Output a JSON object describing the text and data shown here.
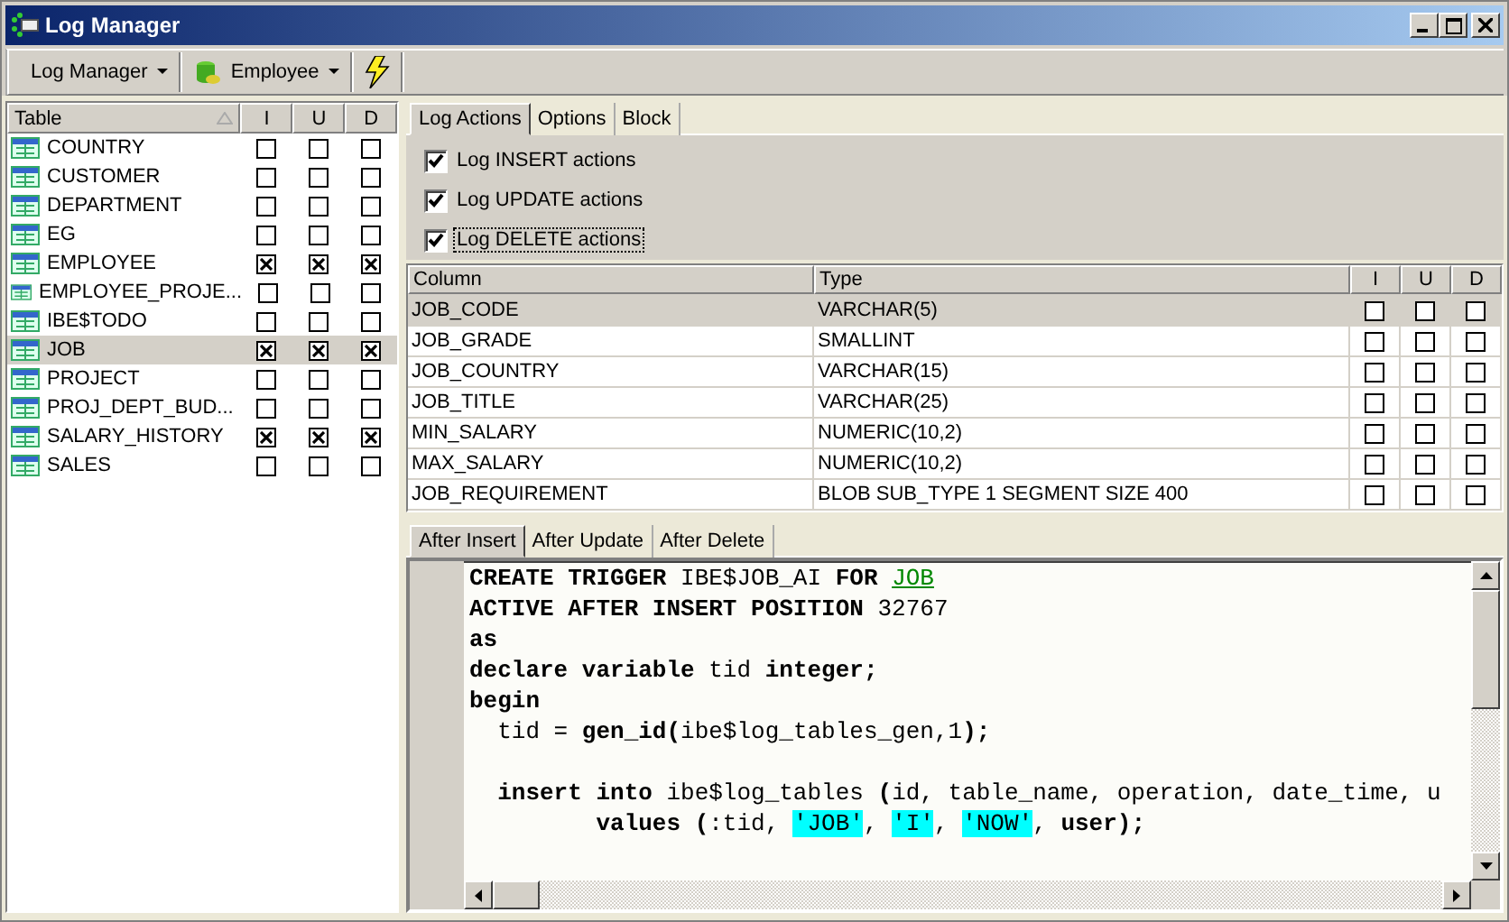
{
  "window": {
    "title": "Log Manager"
  },
  "toolbar": {
    "items": [
      {
        "kind": "dropdown",
        "label": "Log Manager",
        "icon": false
      },
      {
        "kind": "dropdown",
        "label": "Employee",
        "icon": true
      },
      {
        "kind": "action"
      }
    ]
  },
  "tables_list": {
    "columns": [
      "Table",
      "I",
      "U",
      "D"
    ],
    "rows": [
      {
        "name": "COUNTRY",
        "insert": false,
        "update": false,
        "delete": false,
        "selected": false
      },
      {
        "name": "CUSTOMER",
        "insert": false,
        "update": false,
        "delete": false,
        "selected": false
      },
      {
        "name": "DEPARTMENT",
        "insert": false,
        "update": false,
        "delete": false,
        "selected": false
      },
      {
        "name": "EG",
        "insert": false,
        "update": false,
        "delete": false,
        "selected": false
      },
      {
        "name": "EMPLOYEE",
        "insert": true,
        "update": true,
        "delete": true,
        "selected": false
      },
      {
        "name": "EMPLOYEE_PROJE...",
        "insert": false,
        "update": false,
        "delete": false,
        "selected": false
      },
      {
        "name": "IBE$TODO",
        "insert": false,
        "update": false,
        "delete": false,
        "selected": false
      },
      {
        "name": "JOB",
        "insert": true,
        "update": true,
        "delete": true,
        "selected": true
      },
      {
        "name": "PROJECT",
        "insert": false,
        "update": false,
        "delete": false,
        "selected": false
      },
      {
        "name": "PROJ_DEPT_BUD...",
        "insert": false,
        "update": false,
        "delete": false,
        "selected": false
      },
      {
        "name": "SALARY_HISTORY",
        "insert": true,
        "update": true,
        "delete": true,
        "selected": false
      },
      {
        "name": "SALES",
        "insert": false,
        "update": false,
        "delete": false,
        "selected": false
      }
    ]
  },
  "tabs": [
    {
      "label": "Log Actions",
      "selected": true
    },
    {
      "label": "Options",
      "selected": false
    },
    {
      "label": "Block",
      "selected": false
    }
  ],
  "options": [
    {
      "label": "Log INSERT actions",
      "checked": true,
      "focused": false
    },
    {
      "label": "Log UPDATE actions",
      "checked": true,
      "focused": false
    },
    {
      "label": "Log DELETE actions",
      "checked": true,
      "focused": true
    }
  ],
  "columns_grid": {
    "columns": [
      "Column",
      "Type",
      "I",
      "U",
      "D"
    ],
    "rows": [
      {
        "column": "JOB_CODE",
        "type": "VARCHAR(5)",
        "insert": false,
        "update": false,
        "delete": false,
        "selected": true
      },
      {
        "column": "JOB_GRADE",
        "type": "SMALLINT",
        "insert": false,
        "update": false,
        "delete": false,
        "selected": false
      },
      {
        "column": "JOB_COUNTRY",
        "type": "VARCHAR(15)",
        "insert": false,
        "update": false,
        "delete": false,
        "selected": false
      },
      {
        "column": "JOB_TITLE",
        "type": "VARCHAR(25)",
        "insert": false,
        "update": false,
        "delete": false,
        "selected": false
      },
      {
        "column": "MIN_SALARY",
        "type": "NUMERIC(10,2)",
        "insert": false,
        "update": false,
        "delete": false,
        "selected": false
      },
      {
        "column": "MAX_SALARY",
        "type": "NUMERIC(10,2)",
        "insert": false,
        "update": false,
        "delete": false,
        "selected": false
      },
      {
        "column": "JOB_REQUIREMENT",
        "type": "BLOB SUB_TYPE 1 SEGMENT SIZE 400",
        "insert": false,
        "update": false,
        "delete": false,
        "selected": false
      }
    ]
  },
  "trigger_tabs": [
    {
      "label": "After Insert",
      "selected": true
    },
    {
      "label": "After Update",
      "selected": false
    },
    {
      "label": "After Delete",
      "selected": false
    }
  ],
  "code_lines": [
    {
      "kind": "code",
      "segments": [
        {
          "text": "CREATE TRIGGER",
          "kind": "keyword"
        },
        {
          "text": " IBE$JOB_AI ",
          "kind": "plain"
        },
        {
          "text": "FOR ",
          "kind": "keyword"
        },
        {
          "text": "JOB",
          "kind": "object"
        }
      ]
    },
    {
      "kind": "code",
      "segments": [
        {
          "text": "ACTIVE AFTER INSERT POSITION",
          "kind": "keyword"
        },
        {
          "text": " 32767",
          "kind": "plain"
        }
      ]
    },
    {
      "kind": "code",
      "segments": [
        {
          "text": "as",
          "kind": "keyword"
        }
      ]
    },
    {
      "kind": "code",
      "segments": [
        {
          "text": "declare variable",
          "kind": "keyword"
        },
        {
          "text": " tid ",
          "kind": "plain"
        },
        {
          "text": "integer;",
          "kind": "keyword"
        }
      ]
    },
    {
      "kind": "code",
      "segments": [
        {
          "text": "begin",
          "kind": "keyword"
        }
      ]
    },
    {
      "kind": "code",
      "segments": [
        {
          "text": "  tid = ",
          "kind": "plain"
        },
        {
          "text": "gen_id(",
          "kind": "keyword"
        },
        {
          "text": "ibe$log_tables_gen,1",
          "kind": "plain"
        },
        {
          "text": ");",
          "kind": "keyword"
        }
      ]
    },
    {
      "kind": "blank"
    },
    {
      "kind": "code",
      "segments": [
        {
          "text": "  insert into",
          "kind": "keyword"
        },
        {
          "text": " ibe$log_tables ",
          "kind": "plain"
        },
        {
          "text": "(",
          "kind": "keyword"
        },
        {
          "text": "id, table_name, operation, date_time, u",
          "kind": "plain"
        }
      ]
    },
    {
      "kind": "code",
      "segments": [
        {
          "text": "         values (",
          "kind": "keyword"
        },
        {
          "text": ":tid, ",
          "kind": "plain"
        },
        {
          "text": "'JOB'",
          "kind": "string"
        },
        {
          "text": ", ",
          "kind": "plain"
        },
        {
          "text": "'I'",
          "kind": "string"
        },
        {
          "text": ", ",
          "kind": "plain"
        },
        {
          "text": "'NOW'",
          "kind": "string"
        },
        {
          "text": ", ",
          "kind": "plain"
        },
        {
          "text": "user);",
          "kind": "keyword"
        }
      ]
    }
  ]
}
